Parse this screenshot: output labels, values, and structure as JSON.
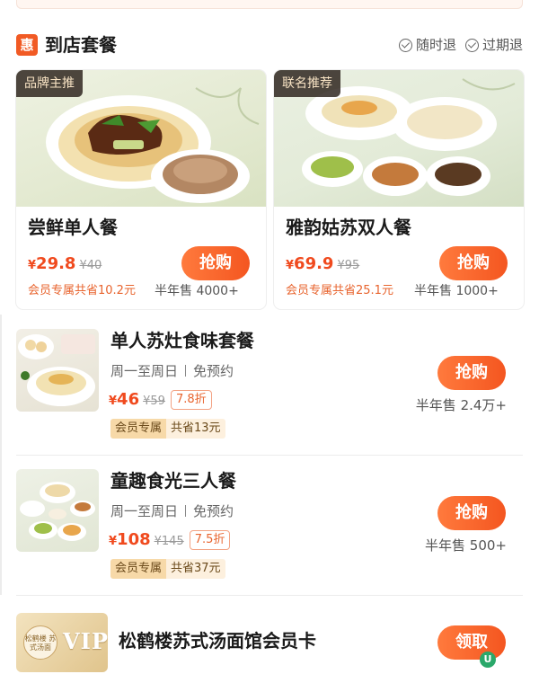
{
  "section": {
    "icon_text": "惠",
    "title": "到店套餐",
    "policies": [
      "随时退",
      "过期退"
    ]
  },
  "cards": [
    {
      "tag": "品牌主推",
      "name": "尝鲜单人餐",
      "price": "29.8",
      "original_price": "¥40",
      "member_note": "会员专属共省10.2元",
      "sales": "半年售 4000+",
      "button": "抢购"
    },
    {
      "tag": "联名推荐",
      "name": "雅韵姑苏双人餐",
      "price": "69.9",
      "original_price": "¥95",
      "member_note": "会员专属共省25.1元",
      "sales": "半年售 1000+",
      "button": "抢购"
    }
  ],
  "currency": "¥",
  "rows": [
    {
      "title": "单人苏灶食味套餐",
      "days": "周一至周日",
      "reservation": "免预约",
      "price": "46",
      "original_price": "¥59",
      "discount": "7.8折",
      "badge_label": "会员专属",
      "badge_value": "共省13元",
      "sales": "半年售 2.4万+",
      "button": "抢购"
    },
    {
      "title": "童趣食光三人餐",
      "days": "周一至周日",
      "reservation": "免预约",
      "price": "108",
      "original_price": "¥145",
      "discount": "7.5折",
      "badge_label": "会员专属",
      "badge_value": "共省37元",
      "sales": "半年售 500+",
      "button": "抢购"
    }
  ],
  "vip": {
    "logo_text": "松鹤楼 苏式汤面",
    "card_text": "VIP",
    "title": "松鹤楼苏式汤面馆会员卡",
    "button": "领取"
  },
  "colors": {
    "accent": "#f45620",
    "price": "#f04a1e",
    "badge_bg": "#f7d9a8"
  }
}
